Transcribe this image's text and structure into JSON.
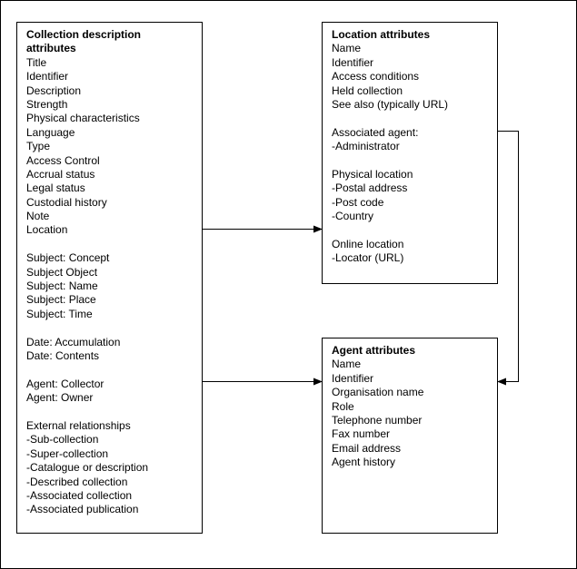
{
  "collection_box": {
    "title": [
      "Collection description",
      "attributes"
    ],
    "items": [
      "Title",
      "Identifier",
      "Description",
      "Strength",
      "Physical characteristics",
      "Language",
      "Type",
      "Access Control",
      "Accrual status",
      "Legal status",
      "Custodial history",
      "Note",
      "Location",
      "",
      "Subject: Concept",
      "Subject Object",
      "Subject: Name",
      "Subject: Place",
      "Subject: Time",
      "",
      "Date: Accumulation",
      "Date: Contents",
      "",
      "Agent: Collector",
      "Agent: Owner",
      "",
      "External relationships",
      "-Sub-collection",
      "-Super-collection",
      "-Catalogue or description",
      "-Described collection",
      "-Associated collection",
      "-Associated publication"
    ]
  },
  "location_box": {
    "title": [
      "Location attributes"
    ],
    "items": [
      "Name",
      "Identifier",
      "Access conditions",
      "Held collection",
      "See also (typically URL)",
      "",
      "Associated agent:",
      "-Administrator",
      "",
      "Physical location",
      "-Postal address",
      "-Post code",
      "-Country",
      "",
      "Online location",
      "-Locator (URL)"
    ]
  },
  "agent_box": {
    "title": [
      "Agent attributes"
    ],
    "items": [
      "Name",
      "Identifier",
      "Organisation name",
      "Role",
      "Telephone number",
      "Fax number",
      "Email address",
      "Agent history"
    ]
  },
  "connections": [
    {
      "from": "Collection description attributes (Location)",
      "to": "Location attributes"
    },
    {
      "from": "Collection description attributes (Agent)",
      "to": "Agent attributes"
    },
    {
      "from": "Location attributes (Associated agent)",
      "to": "Agent attributes"
    }
  ]
}
